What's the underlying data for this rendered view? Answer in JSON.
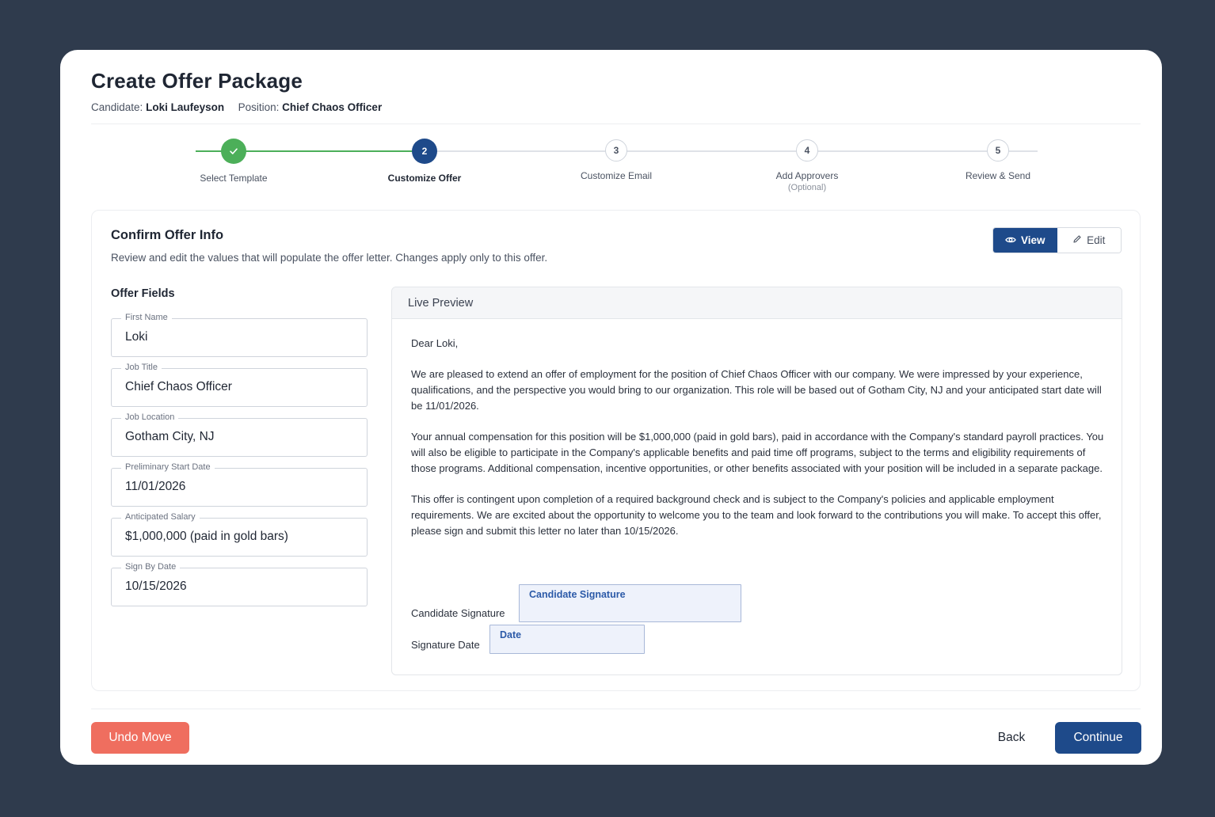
{
  "header": {
    "title": "Create Offer Package",
    "candidate_label": "Candidate:",
    "candidate_name": "Loki Laufeyson",
    "position_label": "Position:",
    "position_name": "Chief Chaos Officer"
  },
  "stepper": {
    "steps": [
      {
        "number": "✓",
        "label": "Select Template",
        "sub": "",
        "state": "done"
      },
      {
        "number": "2",
        "label": "Customize Offer",
        "sub": "",
        "state": "active"
      },
      {
        "number": "3",
        "label": "Customize Email",
        "sub": "",
        "state": "todo"
      },
      {
        "number": "4",
        "label": "Add Approvers",
        "sub": "(Optional)",
        "state": "todo"
      },
      {
        "number": "5",
        "label": "Review & Send",
        "sub": "",
        "state": "todo"
      }
    ]
  },
  "panel": {
    "title": "Confirm Offer Info",
    "description": "Review and edit the values that will populate the offer letter. Changes apply only to this offer.",
    "view_label": "View",
    "edit_label": "Edit",
    "fields_title": "Offer Fields",
    "fields": [
      {
        "label": "First Name",
        "value": "Loki"
      },
      {
        "label": "Job Title",
        "value": "Chief Chaos Officer"
      },
      {
        "label": "Job Location",
        "value": "Gotham City, NJ"
      },
      {
        "label": "Preliminary Start Date",
        "value": "11/01/2026"
      },
      {
        "label": "Anticipated Salary",
        "value": "$1,000,000 (paid in gold bars)"
      },
      {
        "label": "Sign By Date",
        "value": "10/15/2026"
      }
    ]
  },
  "preview": {
    "title": "Live Preview",
    "greeting": "Dear Loki,",
    "paragraphs": [
      "We are pleased to extend an offer of employment for the position of Chief Chaos Officer with our company. We were impressed by your experience, qualifications, and the perspective you would bring to our organization. This role will be based out of Gotham City, NJ and your anticipated start date will be 11/01/2026.",
      "Your annual compensation for this position will be $1,000,000 (paid in gold bars), paid in accordance with the Company's standard payroll practices. You will also be eligible to participate in the Company's applicable benefits and paid time off programs, subject to the terms and eligibility requirements of those programs. Additional compensation, incentive opportunities, or other benefits associated with your position will be included in a separate package.",
      "This offer is contingent upon completion of a required background check and is subject to the Company's policies and applicable employment requirements. We are excited about the opportunity to welcome you to the team and look forward to the contributions you will make. To accept this offer, please sign and submit this letter no later than 10/15/2026."
    ],
    "candidate_signature_label": "Candidate Signature",
    "candidate_signature_box": "Candidate Signature",
    "signature_date_label": "Signature Date",
    "signature_date_box": "Date"
  },
  "footer": {
    "undo_label": "Undo Move",
    "back_label": "Back",
    "continue_label": "Continue"
  },
  "colors": {
    "primary": "#1e4a8a",
    "success": "#4caf59",
    "danger": "#ef6e5f",
    "background": "#2f3b4d"
  }
}
